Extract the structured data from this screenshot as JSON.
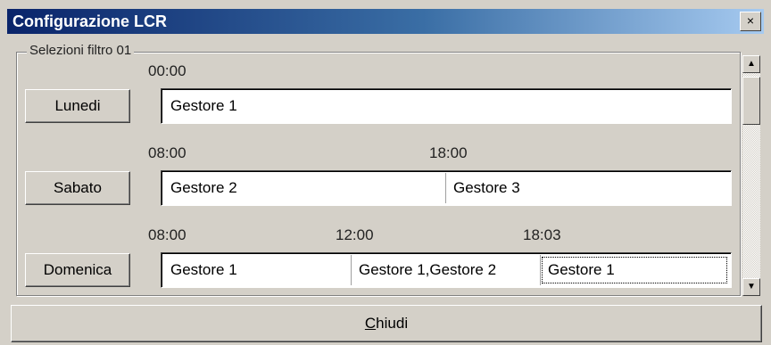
{
  "window": {
    "title": "Configurazione LCR",
    "close_glyph": "×"
  },
  "group": {
    "label": "Selezioni filtro 01"
  },
  "rows": [
    {
      "day": "Lunedi",
      "times": [
        "00:00"
      ],
      "segments": [
        "Gestore 1"
      ]
    },
    {
      "day": "Sabato",
      "times": [
        "08:00",
        "18:00"
      ],
      "segments": [
        "Gestore 2",
        "Gestore 3"
      ]
    },
    {
      "day": "Domenica",
      "times": [
        "08:00",
        "12:00",
        "18:03"
      ],
      "segments": [
        "Gestore 1",
        "Gestore 1,Gestore 2",
        "Gestore 1"
      ]
    }
  ],
  "footer": {
    "close_label_first": "C",
    "close_label_rest": "hiudi"
  },
  "scrollbar": {
    "up_glyph": "▲",
    "down_glyph": "▼"
  }
}
